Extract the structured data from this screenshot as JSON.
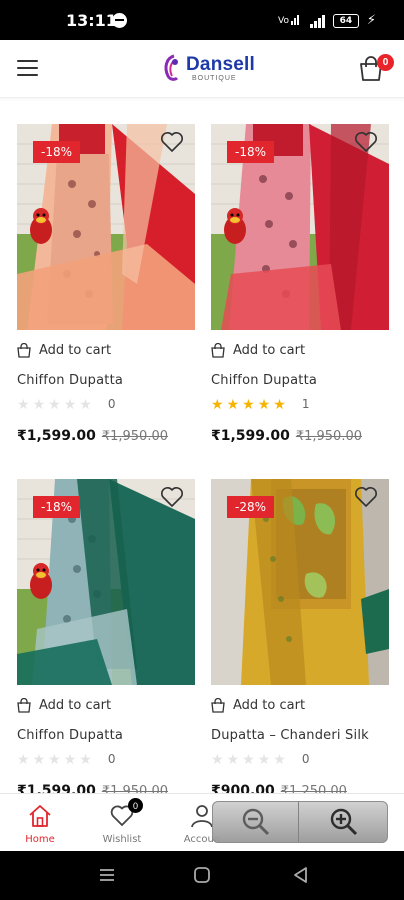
{
  "status_bar": {
    "time": "13:11",
    "battery": "64"
  },
  "header": {
    "logo_name": "Dansell",
    "logo_sub": "BOUTIQUE",
    "cart_count": "0",
    "icons": [
      "menu-icon",
      "cart-icon"
    ]
  },
  "products": [
    {
      "discount": "-18%",
      "add_to_cart": "Add to cart",
      "name": "Chiffon Dupatta",
      "rating": 0,
      "rating_count": "0",
      "price": "₹1,599.00",
      "old_price": "₹1,950.00"
    },
    {
      "discount": "-18%",
      "add_to_cart": "Add to cart",
      "name": "Chiffon Dupatta",
      "rating": 5,
      "rating_count": "1",
      "price": "₹1,599.00",
      "old_price": "₹1,950.00"
    },
    {
      "discount": "-18%",
      "add_to_cart": "Add to cart",
      "name": "Chiffon Dupatta",
      "rating": 0,
      "rating_count": "0",
      "price": "₹1,599.00",
      "old_price": "₹1,950.00"
    },
    {
      "discount": "-28%",
      "add_to_cart": "Add to cart",
      "name": "Dupatta – Chanderi Silk",
      "rating": 0,
      "rating_count": "0",
      "price": "₹900.00",
      "old_price": "₹1,250.00"
    }
  ],
  "bottom_nav": {
    "home": "Home",
    "wishlist": "Wishlist",
    "wishlist_count": "0",
    "account": "Accoun"
  },
  "colors": {
    "accent": "#e2262d",
    "brand": "#1d3aa8",
    "star": "#f4b400"
  }
}
